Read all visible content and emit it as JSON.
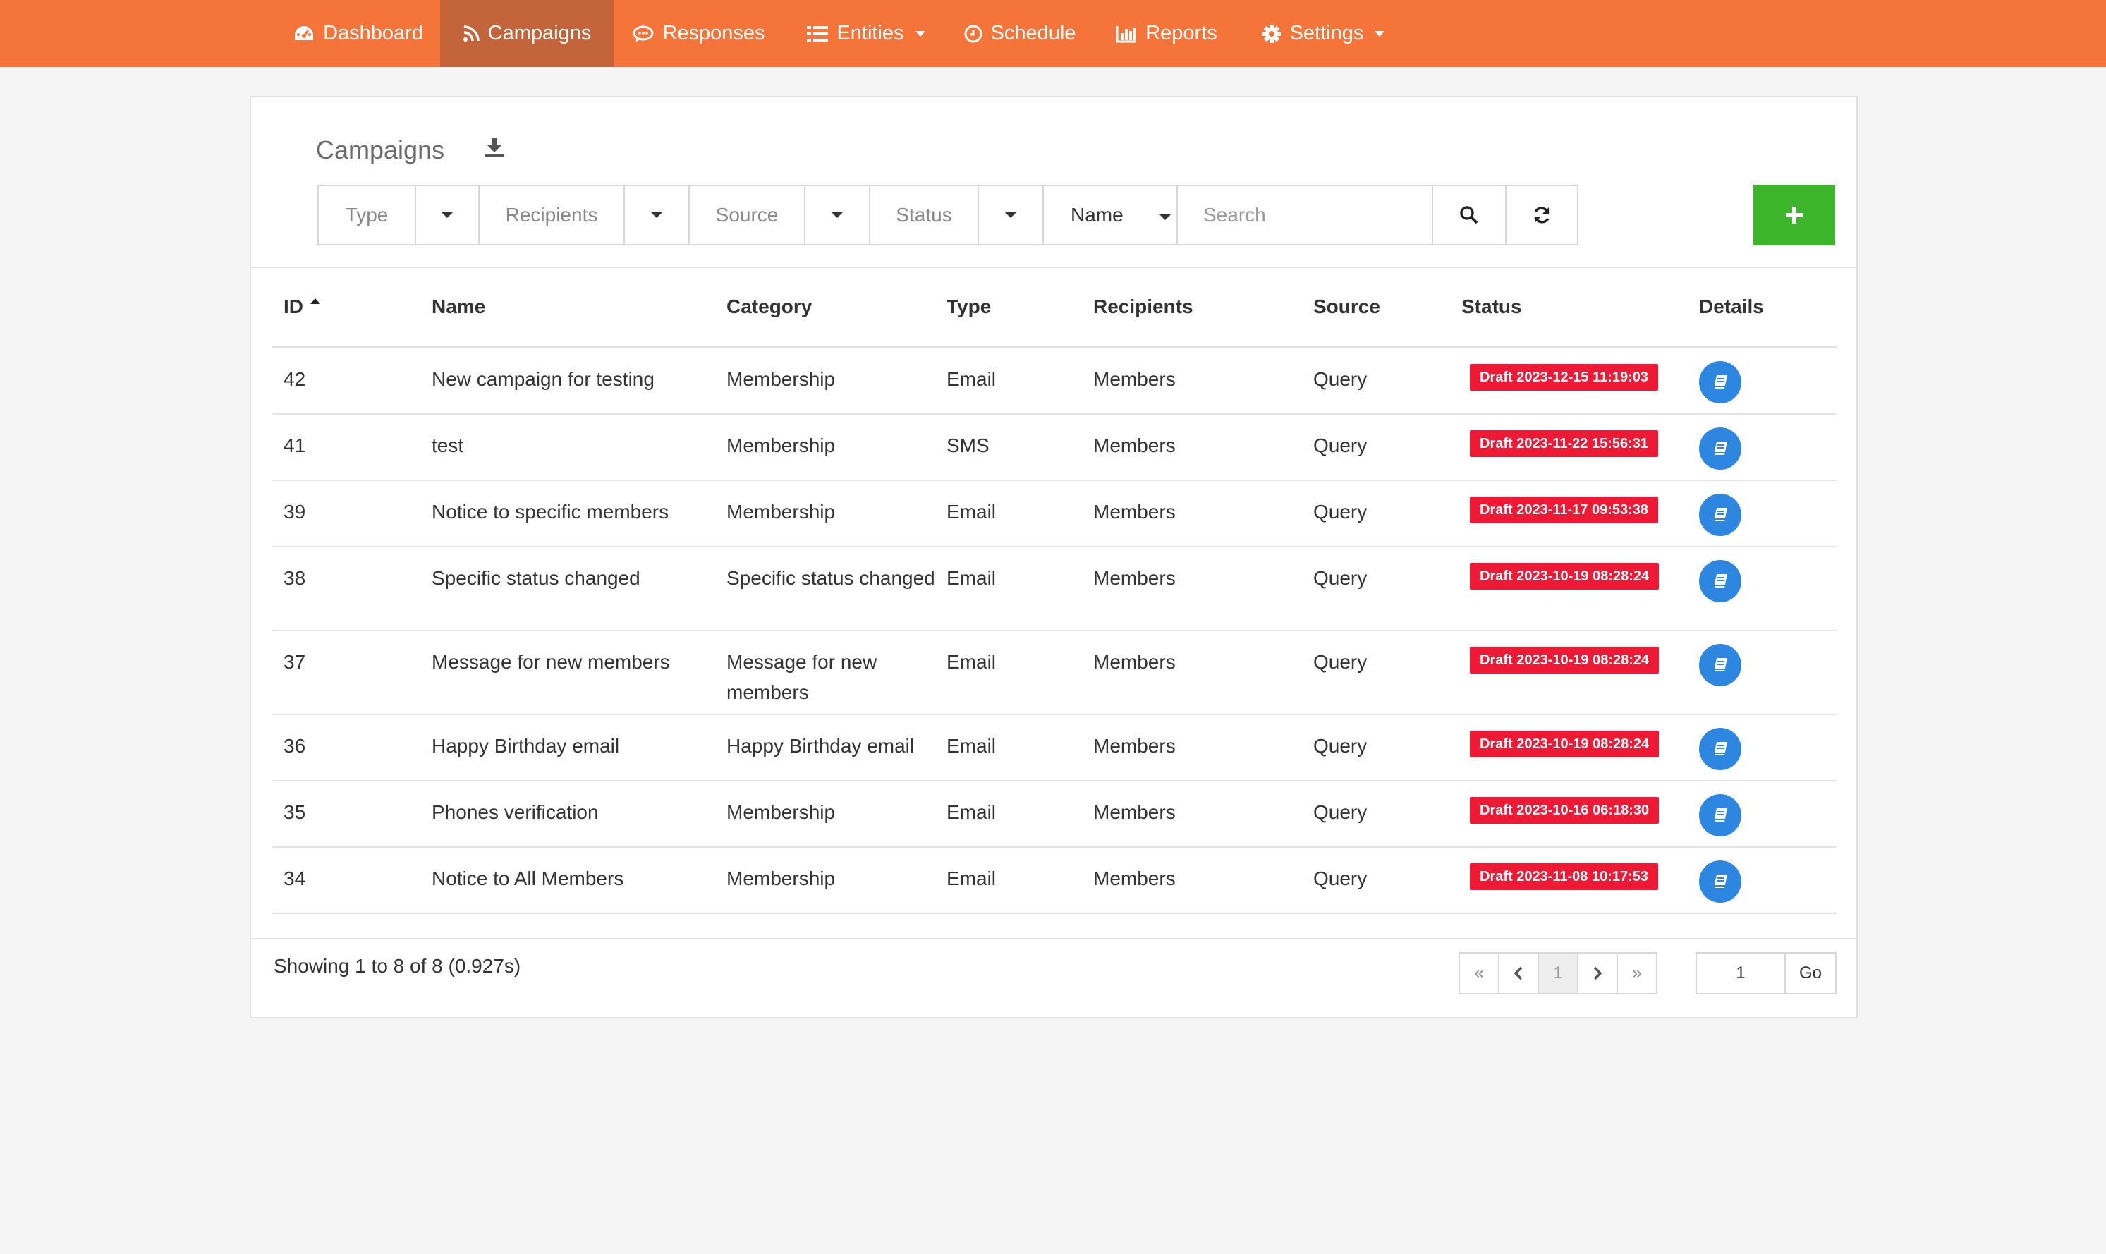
{
  "nav": {
    "items": [
      {
        "label": "Dashboard",
        "icon": "dashboard-icon"
      },
      {
        "label": "Campaigns",
        "icon": "rss-icon",
        "active": true
      },
      {
        "label": "Responses",
        "icon": "comment-icon"
      },
      {
        "label": "Entities",
        "icon": "list-icon",
        "dropdown": true
      },
      {
        "label": "Schedule",
        "icon": "clock-icon"
      },
      {
        "label": "Reports",
        "icon": "bar-chart-icon"
      },
      {
        "label": "Settings",
        "icon": "gear-icon",
        "dropdown": true
      }
    ],
    "color": "#f5743a",
    "active_color": "#c4643b"
  },
  "panel": {
    "title": "Campaigns"
  },
  "filters": {
    "type": "Type",
    "recipients": "Recipients",
    "source": "Source",
    "status": "Status",
    "field_select": "Name",
    "search_placeholder": "Search"
  },
  "table": {
    "columns": [
      "ID",
      "Name",
      "Category",
      "Type",
      "Recipients",
      "Source",
      "Status",
      "Details"
    ],
    "sort_column": "ID",
    "rows": [
      {
        "id": "42",
        "name": "New campaign for testing",
        "category": "Membership",
        "type": "Email",
        "recipients": "Members",
        "source": "Query",
        "status": "Draft 2023-12-15 11:19:03"
      },
      {
        "id": "41",
        "name": "test",
        "category": "Membership",
        "type": "SMS",
        "recipients": "Members",
        "source": "Query",
        "status": "Draft 2023-11-22 15:56:31"
      },
      {
        "id": "39",
        "name": "Notice to specific members",
        "category": "Membership",
        "type": "Email",
        "recipients": "Members",
        "source": "Query",
        "status": "Draft 2023-11-17 09:53:38"
      },
      {
        "id": "38",
        "name": "Specific status changed",
        "category": "Specific status changed",
        "type": "Email",
        "recipients": "Members",
        "source": "Query",
        "status": "Draft 2023-10-19 08:28:24"
      },
      {
        "id": "37",
        "name": "Message for new members",
        "category": "Message for new members",
        "type": "Email",
        "recipients": "Members",
        "source": "Query",
        "status": "Draft 2023-10-19 08:28:24"
      },
      {
        "id": "36",
        "name": "Happy Birthday email",
        "category": "Happy Birthday email",
        "type": "Email",
        "recipients": "Members",
        "source": "Query",
        "status": "Draft 2023-10-19 08:28:24"
      },
      {
        "id": "35",
        "name": "Phones verification",
        "category": "Membership",
        "type": "Email",
        "recipients": "Members",
        "source": "Query",
        "status": "Draft 2023-10-16 06:18:30"
      },
      {
        "id": "34",
        "name": "Notice to All Members",
        "category": "Membership",
        "type": "Email",
        "recipients": "Members",
        "source": "Query",
        "status": "Draft 2023-11-08 10:17:53"
      }
    ],
    "status_color": "#ee1a35",
    "details_color": "#2d86e0"
  },
  "footer": {
    "showing": "Showing 1 to 8 of 8 (0.927s)",
    "current_page": "1",
    "goto_value": "1",
    "go_label": "Go"
  },
  "add_button_color": "#3db52a"
}
